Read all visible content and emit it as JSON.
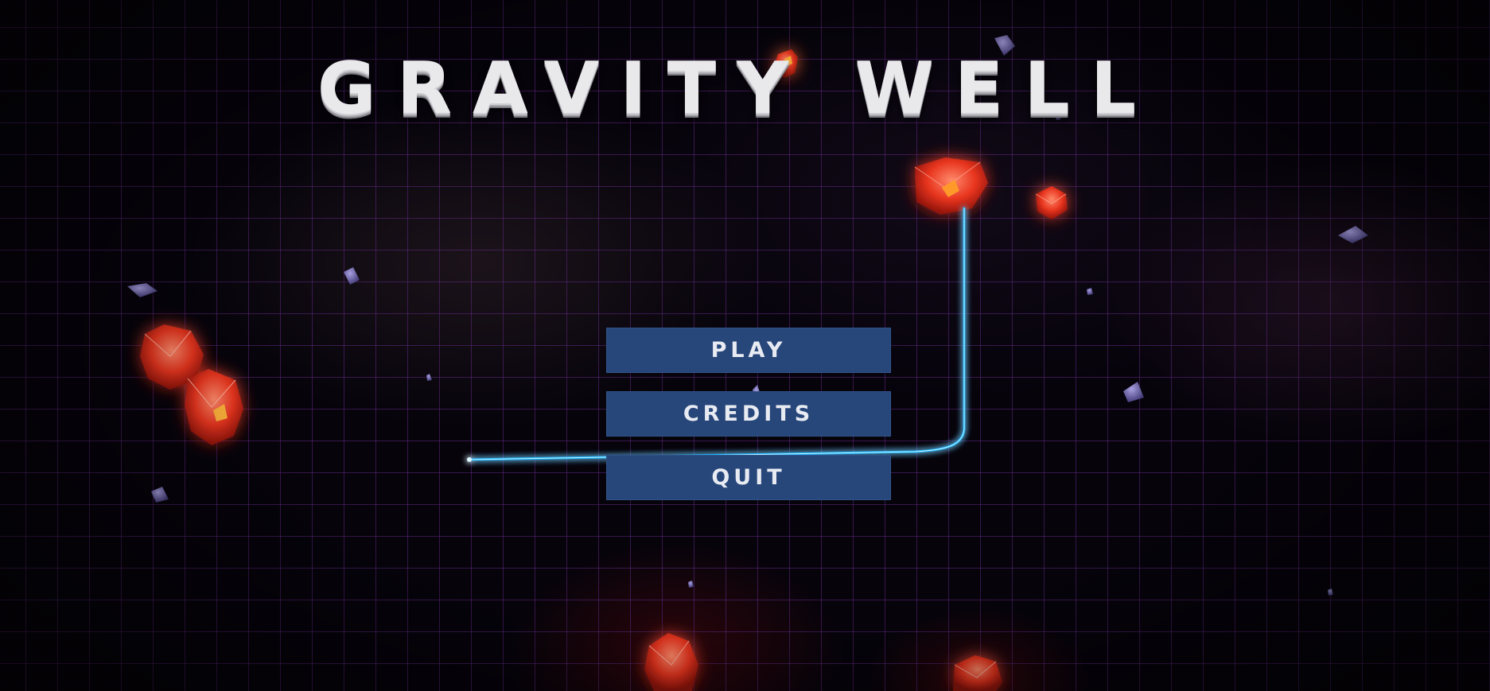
{
  "game": {
    "title": "GRAVITY WELL"
  },
  "menu": {
    "play_label": "PLAY",
    "credits_label": "CREDITS",
    "quit_label": "QUIT"
  },
  "colors": {
    "button_bg": "#27467a",
    "button_text": "#e8ebf2",
    "grid_line": "#5f2882",
    "asteroid_red": "#ff3a1e",
    "trail_cyan": "#1ab8ff"
  }
}
